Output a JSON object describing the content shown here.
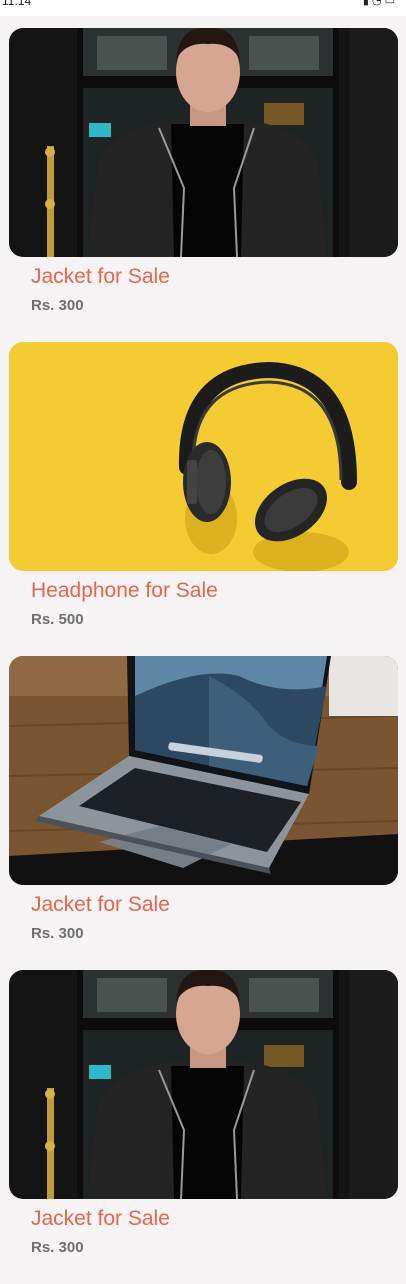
{
  "status_bar": {
    "time": "11:14",
    "icons": [
      "signal-icon",
      "wifi-icon",
      "battery-icon"
    ]
  },
  "listings": [
    {
      "title": "Jacket for Sale",
      "price": "Rs. 300",
      "image": "man-in-leather-jacket-photo"
    },
    {
      "title": "Headphone for Sale",
      "price": "Rs. 500",
      "image": "headphones-on-yellow-photo"
    },
    {
      "title": "Jacket for Sale",
      "price": "Rs. 300",
      "image": "laptop-on-wooden-table-photo"
    },
    {
      "title": "Jacket for Sale",
      "price": "Rs. 300",
      "image": "man-in-leather-jacket-photo"
    }
  ],
  "colors": {
    "background": "#f6f3f4",
    "title": "#e8644b",
    "price": "#6f6f6f",
    "headphone_bg": "#f3c21a"
  }
}
